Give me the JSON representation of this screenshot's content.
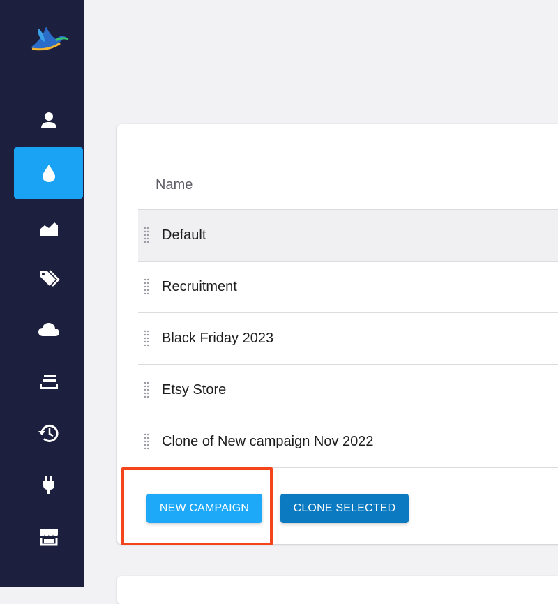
{
  "sidebar": {
    "logo_icon": "bird-logo",
    "items": [
      {
        "icon": "user-icon",
        "active": false
      },
      {
        "icon": "drop-icon",
        "active": true
      },
      {
        "icon": "area-chart-icon",
        "active": false
      },
      {
        "icon": "tags-icon",
        "active": false
      },
      {
        "icon": "cloud-icon",
        "active": false
      },
      {
        "icon": "layers-icon",
        "active": false
      },
      {
        "icon": "history-icon",
        "active": false
      },
      {
        "icon": "plug-icon",
        "active": false
      },
      {
        "icon": "store-icon",
        "active": false
      }
    ],
    "accent_color": "#1aa3f5"
  },
  "table": {
    "header": "Name",
    "rows": [
      {
        "name": "Default"
      },
      {
        "name": "Recruitment"
      },
      {
        "name": "Black Friday 2023"
      },
      {
        "name": "Etsy Store"
      },
      {
        "name": "Clone of New campaign Nov 2022"
      }
    ]
  },
  "actions": {
    "new_label": "NEW CAMPAIGN",
    "clone_label": "CLONE SELECTED"
  },
  "annotation": {
    "color": "#f4441a"
  }
}
